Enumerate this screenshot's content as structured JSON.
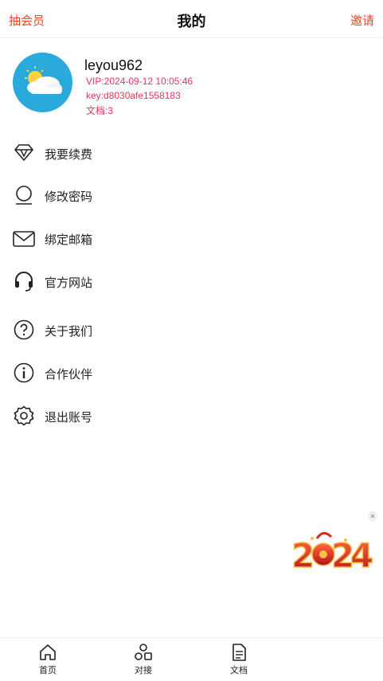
{
  "header": {
    "left_label": "抽会员",
    "title": "我的",
    "right_label": "邀请"
  },
  "profile": {
    "username": "leyou962",
    "vip": "VIP:2024-09-12 10:05:46",
    "key": "key:d8030afe1558183",
    "docs": "文档:3",
    "avatar_icon": "weather-sun-cloud-icon"
  },
  "menu": [
    {
      "label": "我要续费",
      "icon": "diamond-icon"
    },
    {
      "label": "修改密码",
      "icon": "user-icon"
    },
    {
      "label": "绑定邮箱",
      "icon": "mail-icon"
    },
    {
      "label": "官方网站",
      "icon": "headset-icon"
    },
    {
      "label": "关于我们",
      "icon": "question-icon"
    },
    {
      "label": "合作伙伴",
      "icon": "info-icon"
    },
    {
      "label": "退出账号",
      "icon": "gear-icon"
    }
  ],
  "ad": {
    "close": "×"
  },
  "tabbar": [
    {
      "label": "首页",
      "icon": "home-icon"
    },
    {
      "label": "对接",
      "icon": "connect-icon"
    },
    {
      "label": "文档",
      "icon": "document-icon"
    }
  ],
  "colors": {
    "accent": "#e8452c",
    "profile_text": "#e8335a",
    "avatar_bg": "#2aa9dc"
  }
}
